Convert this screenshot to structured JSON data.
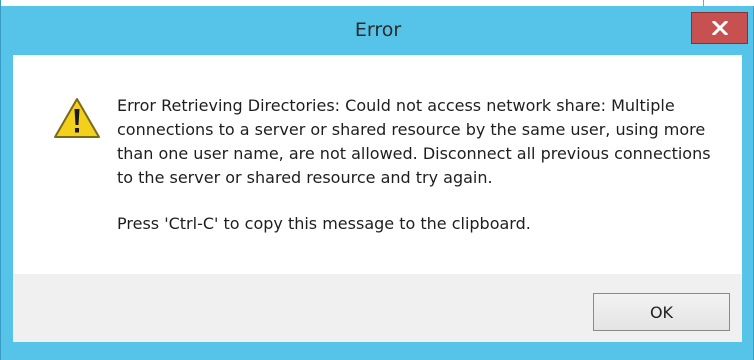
{
  "dialog": {
    "title": "Error",
    "close_icon": "close-x-icon",
    "icon": "warning-icon",
    "colors": {
      "titlebar": "#55c4e8",
      "close_button": "#c75050",
      "warning_fill": "#f3d01b"
    },
    "message": "Error Retrieving Directories: Could not access network share: Multiple connections to a server or shared resource by the same user, using more than one user name, are not allowed. Disconnect all previous connections to the server or shared resource and try again.",
    "hint": "Press 'Ctrl-C' to copy this message to the clipboard.",
    "ok_label": "OK"
  }
}
